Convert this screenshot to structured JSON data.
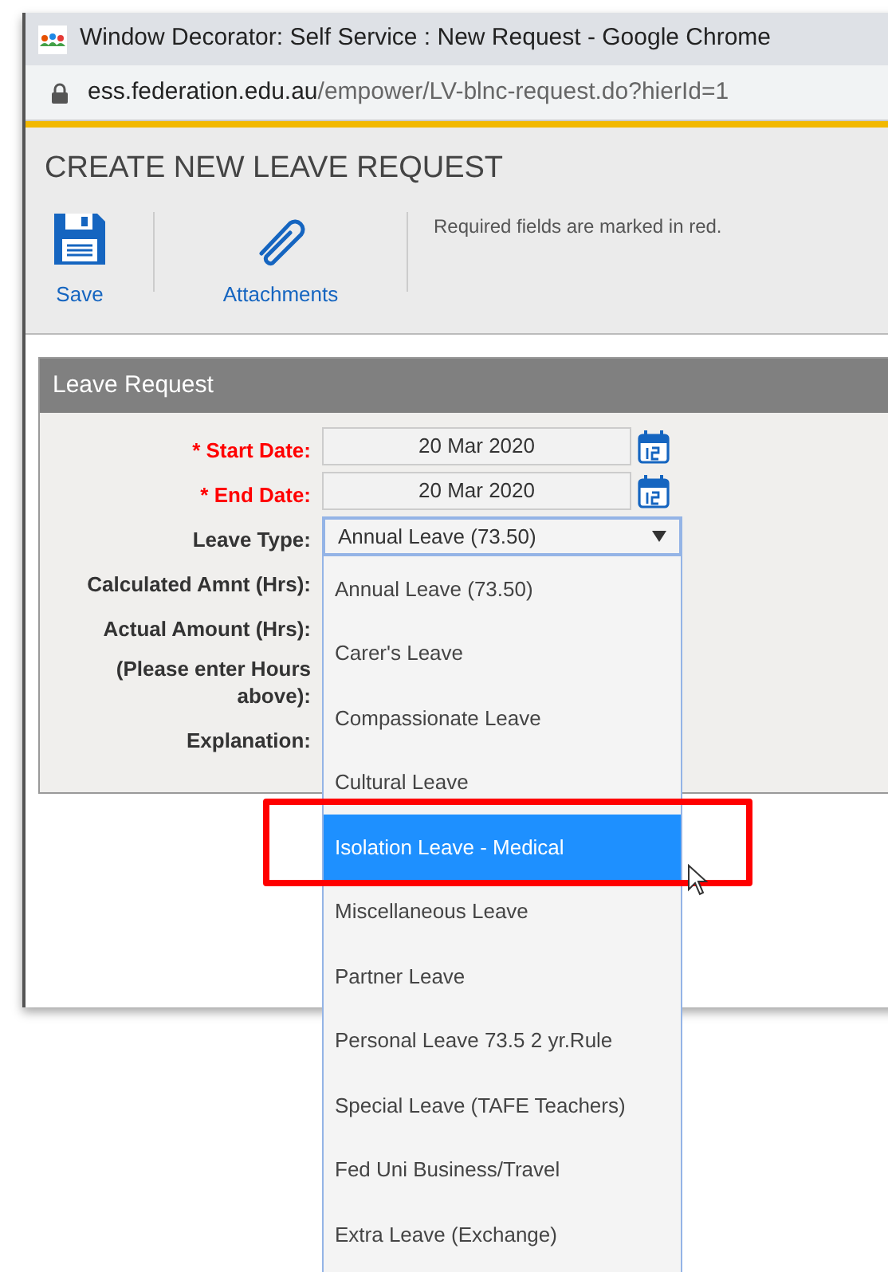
{
  "window": {
    "title": "Window Decorator: Self Service : New Request - Google Chrome"
  },
  "address_bar": {
    "host": "ess.federation.edu.au",
    "path": "/empower/LV-blnc-request.do?hierId=1"
  },
  "page": {
    "heading": "CREATE NEW LEAVE REQUEST",
    "toolbar": [
      {
        "kind": "save",
        "label": "Save"
      },
      {
        "kind": "attach",
        "label": "Attachments"
      }
    ],
    "note": "Required fields are marked in red."
  },
  "panel": {
    "title": "Leave Request",
    "fields": [
      {
        "kind": "date",
        "label": "* Start Date:",
        "required": true,
        "value": "20 Mar 2020"
      },
      {
        "kind": "date",
        "label": "* End Date:",
        "required": true,
        "value": "20 Mar 2020"
      },
      {
        "kind": "select",
        "label": "Leave Type:",
        "required": false,
        "value": "Annual Leave (73.50)"
      },
      {
        "kind": "hidden",
        "label": "Calculated Amnt (Hrs):",
        "required": false
      },
      {
        "kind": "hidden",
        "label": "Actual Amount (Hrs):",
        "required": false
      },
      {
        "kind": "hidden",
        "label": "(Please enter Hours above):",
        "required": false
      },
      {
        "kind": "hidden",
        "label": "Explanation:",
        "required": false
      }
    ]
  },
  "dropdown": {
    "options": [
      {
        "label": "Annual Leave (73.50)",
        "selected": false
      },
      {
        "label": "Carer's Leave",
        "selected": false
      },
      {
        "label": "Compassionate Leave",
        "selected": false
      },
      {
        "label": "Cultural Leave",
        "selected": false
      },
      {
        "label": "Isolation Leave - Medical",
        "selected": true
      },
      {
        "label": "Miscellaneous Leave",
        "selected": false
      },
      {
        "label": "Partner Leave",
        "selected": false
      },
      {
        "label": "Personal Leave 73.5 2 yr.Rule",
        "selected": false
      },
      {
        "label": "Special Leave (TAFE Teachers)",
        "selected": false
      },
      {
        "label": "Fed Uni Business/Travel",
        "selected": false
      },
      {
        "label": "Extra Leave (Exchange)",
        "selected": false
      }
    ]
  }
}
